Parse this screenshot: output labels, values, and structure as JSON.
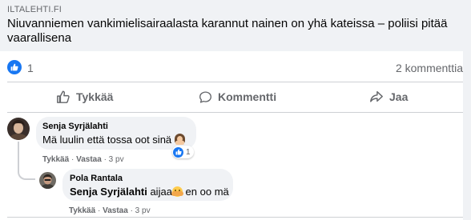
{
  "link_preview": {
    "domain": "ILTALEHTI.FI",
    "headline": "Niuvanniemen vankimielisairaalasta karannut nainen on yhä kateissa – poliisi pitää vaarallisena"
  },
  "stats": {
    "reaction_count": "1",
    "comment_count": "2 kommenttia"
  },
  "actions": {
    "like_label": "Tykkää",
    "comment_label": "Kommentti",
    "share_label": "Jaa"
  },
  "comments": [
    {
      "author": "Senja Syrjälahti",
      "text": "Mä luulin että tossa oot sinä",
      "emoji": "woman-facepalming-emoji",
      "like_label": "Tykkää",
      "reply_label": "Vastaa",
      "time": "3 pv",
      "reaction_count": "1"
    },
    {
      "author": "Pola Rantala",
      "mention": "Senja Syrjälahti",
      "text_before_emoji": "aijaa",
      "emoji": "hands-over-mouth-emoji",
      "text_after_emoji": "en oo mä",
      "like_label": "Tykkää",
      "reply_label": "Vastaa",
      "time": "3 pv"
    }
  ],
  "colors": {
    "accent": "#1877f2",
    "bubble": "#f0f2f5",
    "muted_text": "#65676b"
  }
}
